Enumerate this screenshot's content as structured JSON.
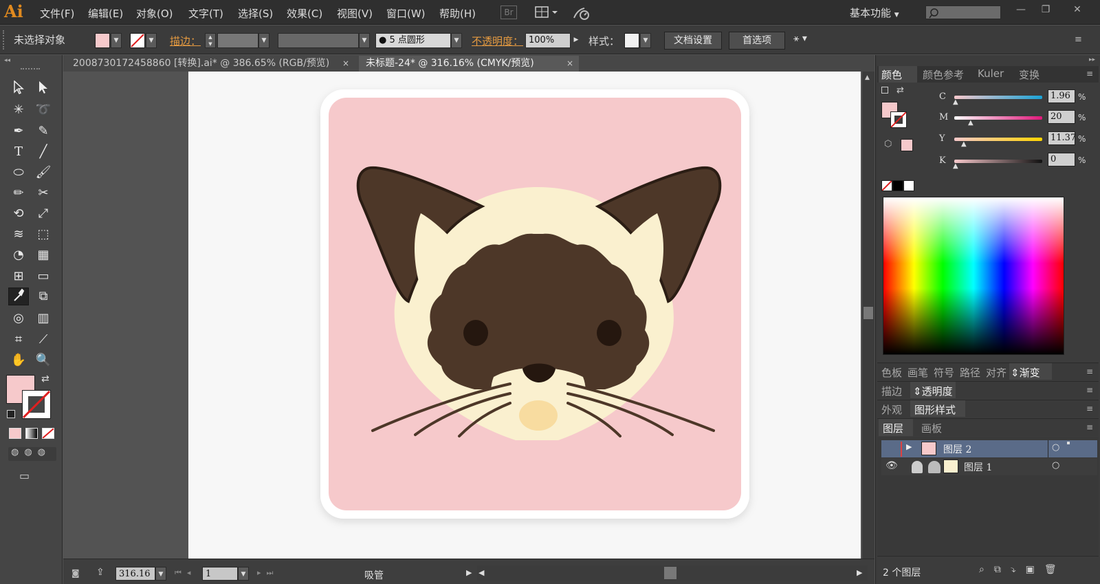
{
  "app": {
    "logo": "Ai"
  },
  "menu": {
    "items": [
      "文件(F)",
      "编辑(E)",
      "对象(O)",
      "文字(T)",
      "选择(S)",
      "效果(C)",
      "视图(V)",
      "窗口(W)",
      "帮助(H)"
    ],
    "bridge": "Br",
    "workspace": "基本功能"
  },
  "control_bar": {
    "selection": "未选择对象",
    "stroke_label": "描边：",
    "brush_value": "5 点圆形",
    "opacity_label": "不透明度：",
    "opacity_value": "100%",
    "style_label": "样式：",
    "doc_setup": "文档设置",
    "preferences": "首选项"
  },
  "tabs": [
    {
      "label": "2008730172458860 [转换].ai* @ 386.65% (RGB/预览)",
      "close": "×",
      "active": false
    },
    {
      "label": "未标题-24* @ 316.16% (CMYK/预览)",
      "close": "×",
      "active": true
    }
  ],
  "status_bar": {
    "zoom": "316.16",
    "artboard_number": "1",
    "current_tool": "吸管"
  },
  "color_panel": {
    "tabs": [
      "颜色",
      "颜色参考",
      "Kuler",
      "变换"
    ],
    "channels": [
      {
        "name": "C",
        "value": "1.96",
        "fraction": 0.02
      },
      {
        "name": "M",
        "value": "20",
        "fraction": 0.2
      },
      {
        "name": "Y",
        "value": "11.37",
        "fraction": 0.11
      },
      {
        "name": "K",
        "value": "0",
        "fraction": 0.0
      }
    ],
    "unit": "%",
    "fill_color": "#f6c9cb"
  },
  "panel_strips": {
    "row1": [
      "色板",
      "画笔",
      "符号",
      "路径",
      "对齐",
      "渐变"
    ],
    "row2": [
      "描边",
      "透明度"
    ],
    "row3": [
      "外观",
      "图形样式"
    ],
    "row4": [
      "图层",
      "画板"
    ]
  },
  "layers": [
    {
      "name": "图层 2",
      "selected": true
    },
    {
      "name": "图层 1",
      "selected": false
    }
  ],
  "layers_footer": "2 个图层",
  "artwork_colors": {
    "background": "#f6c9cb",
    "face": "#faf0cf",
    "dark": "#4d3728",
    "muzzle": "#f8dca0"
  }
}
